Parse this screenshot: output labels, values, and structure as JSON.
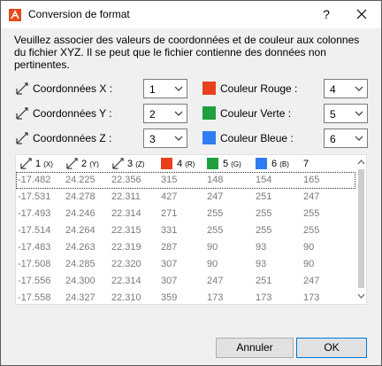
{
  "window": {
    "title": "Conversion de format",
    "help_label": "?"
  },
  "instructions": "Veuillez associer des valeurs de coordonnées et de couleur aux colonnes du fichier XYZ. Il se peut que le fichier contienne des données non pertinentes.",
  "coords": [
    {
      "label": "Coordonnées X :",
      "value": "1"
    },
    {
      "label": "Coordonnées Y :",
      "value": "2"
    },
    {
      "label": "Coordonnées Z :",
      "value": "3"
    }
  ],
  "colors": [
    {
      "label": "Couleur Rouge :",
      "value": "4",
      "swatch": "#e8401c"
    },
    {
      "label": "Couleur Verte :",
      "value": "5",
      "swatch": "#1fa03f"
    },
    {
      "label": "Couleur Bleue :",
      "value": "6",
      "swatch": "#2f7df0"
    }
  ],
  "table": {
    "headers": [
      {
        "num": "1",
        "sub": "(X)"
      },
      {
        "num": "2",
        "sub": "(Y)"
      },
      {
        "num": "3",
        "sub": "(Z)"
      },
      {
        "num": "4",
        "sub": "(R)"
      },
      {
        "num": "5",
        "sub": "(G)"
      },
      {
        "num": "6",
        "sub": "(B)"
      },
      {
        "num": "7",
        "sub": ""
      }
    ],
    "rows": [
      [
        "-17.482",
        "24.225",
        "22.356",
        "315",
        "148",
        "154",
        "165"
      ],
      [
        "-17.531",
        "24.278",
        "22.311",
        "427",
        "247",
        "251",
        "247"
      ],
      [
        "-17.493",
        "24.246",
        "22.314",
        "271",
        "255",
        "255",
        "255"
      ],
      [
        "-17.514",
        "24.264",
        "22.315",
        "331",
        "255",
        "255",
        "255"
      ],
      [
        "-17.483",
        "24.263",
        "22.319",
        "287",
        "90",
        "93",
        "90"
      ],
      [
        "-17.508",
        "24.285",
        "22.320",
        "307",
        "90",
        "93",
        "90"
      ],
      [
        "-17.556",
        "24.300",
        "22.314",
        "307",
        "247",
        "251",
        "247"
      ],
      [
        "-17.558",
        "24.327",
        "22.310",
        "359",
        "173",
        "173",
        "173"
      ]
    ]
  },
  "buttons": {
    "cancel": "Annuler",
    "ok": "OK"
  }
}
